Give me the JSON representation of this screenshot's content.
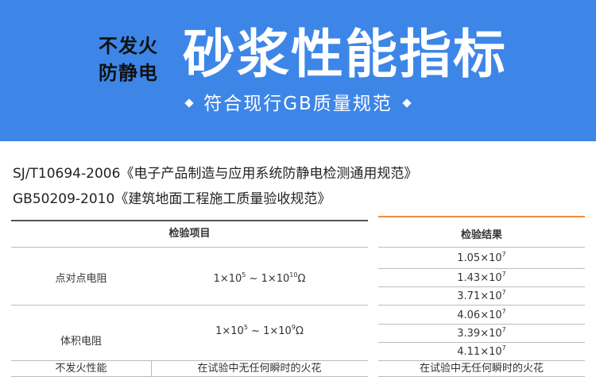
{
  "banner": {
    "small_line1": "不发火",
    "small_line2": "防静电",
    "title": "砂浆性能指标",
    "subtitle": "符合现行GB质量规范",
    "color": "#3d86e8"
  },
  "standards": [
    "SJ/T10694-2006《电子产品制造与应用系统防静电检测通用规范》",
    "GB50209-2010《建筑地面工程施工质量验收规范》"
  ],
  "table": {
    "left_header": "检验项目",
    "right_header": "检验结果",
    "accent_color": "#f08a3c",
    "rows": [
      {
        "item": "点对点电阻",
        "spec_coef1": "1×10",
        "spec_exp1": "5",
        "spec_sep": "~",
        "spec_coef2": "1×10",
        "spec_exp2": "10",
        "spec_unit": "Ω",
        "results": [
          {
            "coef": "1.05×10",
            "exp": "7"
          },
          {
            "coef": "1.43×10",
            "exp": "7"
          },
          {
            "coef": "3.71×10",
            "exp": "7"
          }
        ]
      },
      {
        "item": "体积电阻",
        "spec_coef1": "1×10",
        "spec_exp1": "5",
        "spec_sep": "~",
        "spec_coef2": "1×10",
        "spec_exp2": "9",
        "spec_unit": "Ω",
        "results": [
          {
            "coef": "4.06×10",
            "exp": "7"
          },
          {
            "coef": "3.39×10",
            "exp": "7"
          },
          {
            "coef": "4.11×10",
            "exp": "7"
          }
        ]
      }
    ],
    "last_row": {
      "item": "不发火性能",
      "spec": "在试验中无任何瞬时的火花",
      "result": "在试验中无任何瞬时的火花"
    }
  }
}
